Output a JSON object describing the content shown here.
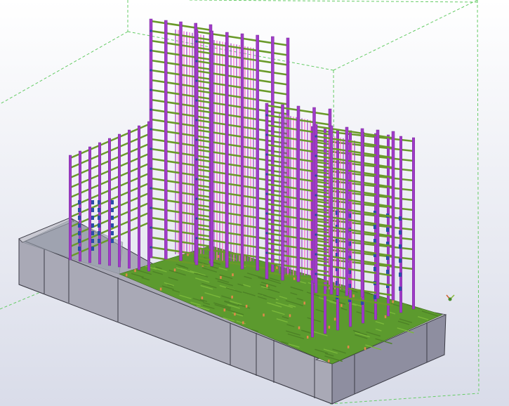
{
  "app": {
    "view": "3d-model-viewport"
  },
  "colors": {
    "background_top": "#ffffff",
    "background_bottom": "#d9dce9",
    "bounding_box": "#66cc66",
    "column": "#a03cc8",
    "column_dark": "#7a2a9a",
    "beam": "#6a9a2a",
    "beam_light": "#88b83a",
    "brace": "#ff66cc",
    "slab": "#5c9a2e",
    "slab_light": "#7ab83a",
    "wall_face": "#a9a9b6",
    "wall_side": "#8e8ea0",
    "wall_top": "#c9c9d2",
    "wall_edge": "#3c3c46",
    "anchor_blue": "#2a4ea8",
    "detail_orange": "#e0894a"
  },
  "icons": {
    "axis_gizmo": "axis-gizmo-icon"
  }
}
